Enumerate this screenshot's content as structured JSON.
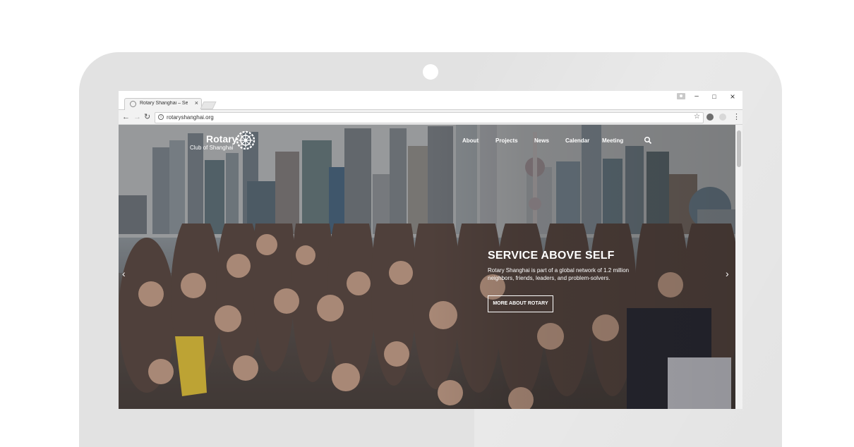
{
  "browser": {
    "tab_title": "Rotary Shanghai – Servic",
    "tab_close": "×",
    "url": "rotaryshanghai.org",
    "window_controls": {
      "minimize": "–",
      "maximize": "□",
      "close": "×"
    }
  },
  "site": {
    "logo_title": "Rotary",
    "logo_subtitle": "Club of Shanghai",
    "nav": [
      "About",
      "Projects",
      "News",
      "Calendar",
      "Meeting"
    ]
  },
  "hero": {
    "title": "SERVICE ABOVE SELF",
    "description": "Rotary Shanghai is part of a global network of 1.2 million neighbors, friends, leaders, and problem-solvers.",
    "button": "MORE ABOUT ROTARY",
    "prev_arrow": "‹",
    "next_arrow": "›"
  },
  "icons": {
    "back": "back-arrow-icon",
    "forward": "forward-arrow-icon",
    "reload": "reload-icon",
    "bookmark": "star-icon",
    "menu": "kebab-menu-icon",
    "search": "search-icon"
  }
}
